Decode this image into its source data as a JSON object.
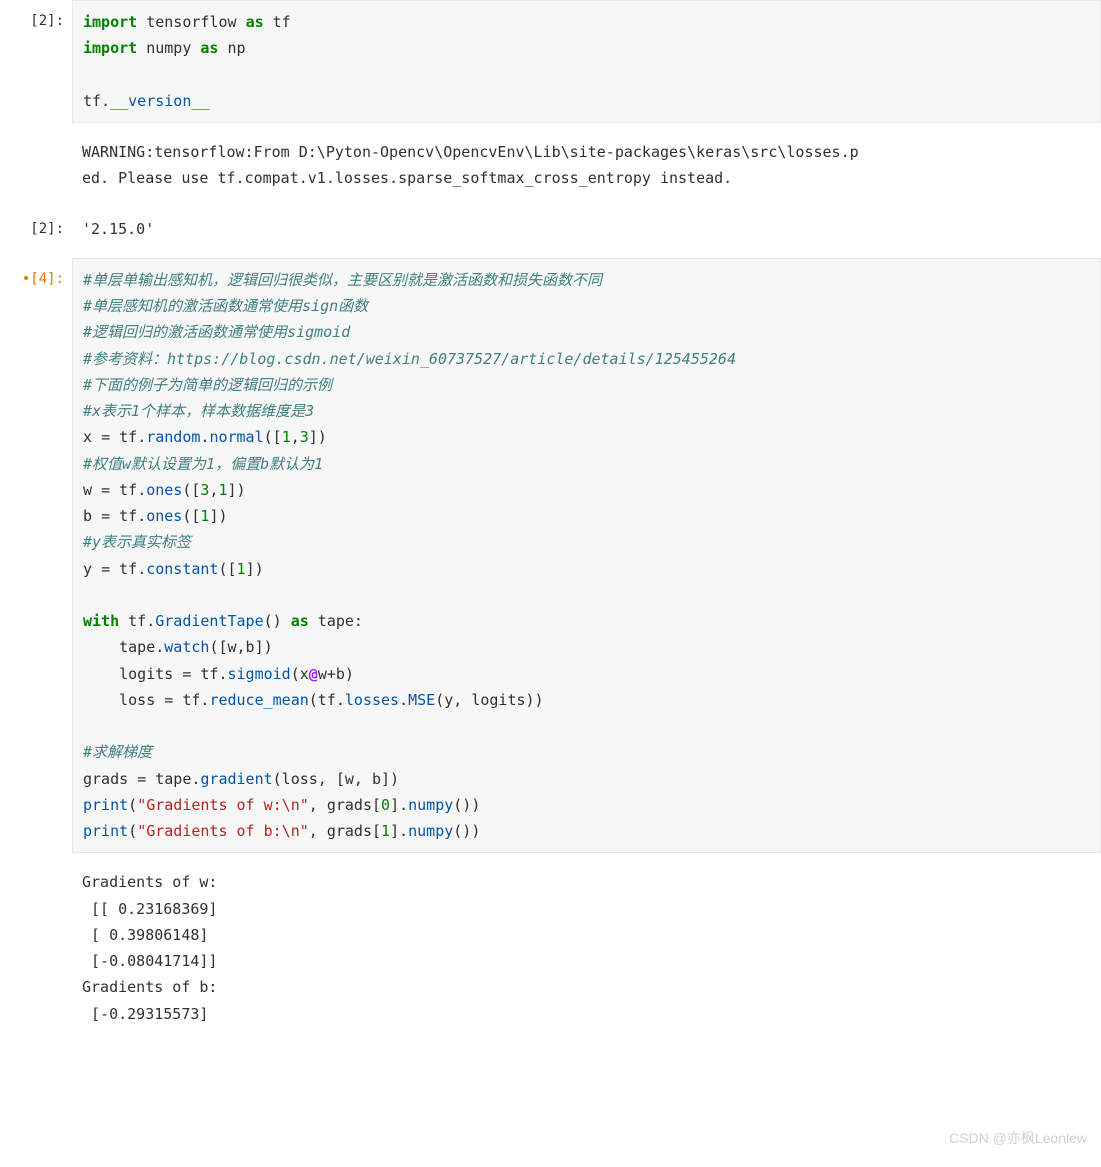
{
  "cells": [
    {
      "prompt": "[2]:",
      "type": "input",
      "mod": false,
      "lines": [
        {
          "cls": "",
          "tokens": [
            {
              "t": "import",
              "c": "kw"
            },
            {
              "t": " tensorflow ",
              "c": "nm"
            },
            {
              "t": "as",
              "c": "kw"
            },
            {
              "t": " tf",
              "c": "nm"
            }
          ]
        },
        {
          "cls": "",
          "tokens": [
            {
              "t": "import",
              "c": "kw"
            },
            {
              "t": " numpy ",
              "c": "nm"
            },
            {
              "t": "as",
              "c": "kw"
            },
            {
              "t": " np",
              "c": "nm"
            }
          ]
        },
        {
          "cls": "",
          "tokens": [
            {
              "t": "",
              "c": "nm"
            }
          ]
        },
        {
          "cls": "",
          "tokens": [
            {
              "t": "tf",
              "c": "nm"
            },
            {
              "t": ".",
              "c": "nm"
            },
            {
              "t": "__version__",
              "c": "fn"
            }
          ]
        }
      ]
    },
    {
      "prompt": "",
      "type": "output",
      "mod": false,
      "plain": "WARNING:tensorflow:From D:\\Pyton-Opencv\\OpencvEnv\\Lib\\site-packages\\keras\\src\\losses.p\ned. Please use tf.compat.v1.losses.sparse_softmax_cross_entropy instead."
    },
    {
      "prompt": "[2]:",
      "type": "output",
      "mod": false,
      "plain": "'2.15.0'"
    },
    {
      "prompt": "[4]:",
      "type": "input",
      "mod": true,
      "lines": [
        {
          "cls": "",
          "tokens": [
            {
              "t": "#单层单输出感知机，逻辑回归很类似，主要区别就是激活函数和损失函数不同",
              "c": "cmt"
            }
          ]
        },
        {
          "cls": "",
          "tokens": [
            {
              "t": "#单层感知机的激活函数通常使用sign函数",
              "c": "cmt"
            }
          ]
        },
        {
          "cls": "",
          "tokens": [
            {
              "t": "#逻辑回归的激活函数通常使用sigmoid",
              "c": "cmt"
            }
          ]
        },
        {
          "cls": "",
          "tokens": [
            {
              "t": "#参考资料：https://blog.csdn.net/weixin_60737527/article/details/125455264",
              "c": "cmt"
            }
          ]
        },
        {
          "cls": "",
          "tokens": [
            {
              "t": "#下面的例子为简单的逻辑回归的示例",
              "c": "cmt"
            }
          ]
        },
        {
          "cls": "",
          "tokens": [
            {
              "t": "#x表示1个样本，样本数据维度是3",
              "c": "cmt"
            }
          ]
        },
        {
          "cls": "",
          "tokens": [
            {
              "t": "x ",
              "c": "nm"
            },
            {
              "t": "=",
              "c": "nm"
            },
            {
              "t": " tf",
              "c": "nm"
            },
            {
              "t": ".",
              "c": "nm"
            },
            {
              "t": "random",
              "c": "fn"
            },
            {
              "t": ".",
              "c": "nm"
            },
            {
              "t": "normal",
              "c": "fn"
            },
            {
              "t": "([",
              "c": "nm"
            },
            {
              "t": "1",
              "c": "num"
            },
            {
              "t": ",",
              "c": "nm"
            },
            {
              "t": "3",
              "c": "num"
            },
            {
              "t": "])",
              "c": "nm"
            }
          ]
        },
        {
          "cls": "",
          "tokens": [
            {
              "t": "#权值w默认设置为1，偏置b默认为1",
              "c": "cmt"
            }
          ]
        },
        {
          "cls": "",
          "tokens": [
            {
              "t": "w ",
              "c": "nm"
            },
            {
              "t": "=",
              "c": "nm"
            },
            {
              "t": " tf",
              "c": "nm"
            },
            {
              "t": ".",
              "c": "nm"
            },
            {
              "t": "ones",
              "c": "fn"
            },
            {
              "t": "([",
              "c": "nm"
            },
            {
              "t": "3",
              "c": "num"
            },
            {
              "t": ",",
              "c": "nm"
            },
            {
              "t": "1",
              "c": "num"
            },
            {
              "t": "])",
              "c": "nm"
            }
          ]
        },
        {
          "cls": "",
          "tokens": [
            {
              "t": "b ",
              "c": "nm"
            },
            {
              "t": "=",
              "c": "nm"
            },
            {
              "t": " tf",
              "c": "nm"
            },
            {
              "t": ".",
              "c": "nm"
            },
            {
              "t": "ones",
              "c": "fn"
            },
            {
              "t": "([",
              "c": "nm"
            },
            {
              "t": "1",
              "c": "num"
            },
            {
              "t": "])",
              "c": "nm"
            }
          ]
        },
        {
          "cls": "",
          "tokens": [
            {
              "t": "#y表示真实标签",
              "c": "cmt"
            }
          ]
        },
        {
          "cls": "",
          "tokens": [
            {
              "t": "y ",
              "c": "nm"
            },
            {
              "t": "=",
              "c": "nm"
            },
            {
              "t": " tf",
              "c": "nm"
            },
            {
              "t": ".",
              "c": "nm"
            },
            {
              "t": "constant",
              "c": "fn"
            },
            {
              "t": "([",
              "c": "nm"
            },
            {
              "t": "1",
              "c": "num"
            },
            {
              "t": "])",
              "c": "nm"
            }
          ]
        },
        {
          "cls": "",
          "tokens": [
            {
              "t": "",
              "c": "nm"
            }
          ]
        },
        {
          "cls": "",
          "tokens": [
            {
              "t": "with",
              "c": "kw"
            },
            {
              "t": " tf",
              "c": "nm"
            },
            {
              "t": ".",
              "c": "nm"
            },
            {
              "t": "GradientTape",
              "c": "fn"
            },
            {
              "t": "() ",
              "c": "nm"
            },
            {
              "t": "as",
              "c": "kw"
            },
            {
              "t": " tape:",
              "c": "nm"
            }
          ]
        },
        {
          "cls": "",
          "tokens": [
            {
              "t": "    tape",
              "c": "nm"
            },
            {
              "t": ".",
              "c": "nm"
            },
            {
              "t": "watch",
              "c": "fn"
            },
            {
              "t": "([w,b])",
              "c": "nm"
            }
          ]
        },
        {
          "cls": "",
          "tokens": [
            {
              "t": "    logits ",
              "c": "nm"
            },
            {
              "t": "=",
              "c": "nm"
            },
            {
              "t": " tf",
              "c": "nm"
            },
            {
              "t": ".",
              "c": "nm"
            },
            {
              "t": "sigmoid",
              "c": "fn"
            },
            {
              "t": "(x",
              "c": "nm"
            },
            {
              "t": "@",
              "c": "op"
            },
            {
              "t": "w",
              "c": "nm"
            },
            {
              "t": "+",
              "c": "nm"
            },
            {
              "t": "b)",
              "c": "nm"
            }
          ]
        },
        {
          "cls": "",
          "tokens": [
            {
              "t": "    loss ",
              "c": "nm"
            },
            {
              "t": "=",
              "c": "nm"
            },
            {
              "t": " tf",
              "c": "nm"
            },
            {
              "t": ".",
              "c": "nm"
            },
            {
              "t": "reduce_mean",
              "c": "fn"
            },
            {
              "t": "(tf",
              "c": "nm"
            },
            {
              "t": ".",
              "c": "nm"
            },
            {
              "t": "losses",
              "c": "fn"
            },
            {
              "t": ".",
              "c": "nm"
            },
            {
              "t": "MSE",
              "c": "fn"
            },
            {
              "t": "(y, logits))",
              "c": "nm"
            }
          ]
        },
        {
          "cls": "",
          "tokens": [
            {
              "t": "",
              "c": "nm"
            }
          ]
        },
        {
          "cls": "",
          "tokens": [
            {
              "t": "#求解梯度",
              "c": "cmt"
            }
          ]
        },
        {
          "cls": "",
          "tokens": [
            {
              "t": "grads ",
              "c": "nm"
            },
            {
              "t": "=",
              "c": "nm"
            },
            {
              "t": " tape",
              "c": "nm"
            },
            {
              "t": ".",
              "c": "nm"
            },
            {
              "t": "gradient",
              "c": "fn"
            },
            {
              "t": "(loss, [w, b])",
              "c": "nm"
            }
          ]
        },
        {
          "cls": "",
          "tokens": [
            {
              "t": "print",
              "c": "fn"
            },
            {
              "t": "(",
              "c": "nm"
            },
            {
              "t": "\"Gradients of w:\\n\"",
              "c": "str"
            },
            {
              "t": ", grads[",
              "c": "nm"
            },
            {
              "t": "0",
              "c": "num"
            },
            {
              "t": "]",
              "c": "nm"
            },
            {
              "t": ".",
              "c": "nm"
            },
            {
              "t": "numpy",
              "c": "fn"
            },
            {
              "t": "())",
              "c": "nm"
            }
          ]
        },
        {
          "cls": "",
          "tokens": [
            {
              "t": "print",
              "c": "fn"
            },
            {
              "t": "(",
              "c": "nm"
            },
            {
              "t": "\"Gradients of b:\\n\"",
              "c": "str"
            },
            {
              "t": ", grads[",
              "c": "nm"
            },
            {
              "t": "1",
              "c": "num"
            },
            {
              "t": "]",
              "c": "nm"
            },
            {
              "t": ".",
              "c": "nm"
            },
            {
              "t": "numpy",
              "c": "fn"
            },
            {
              "t": "())",
              "c": "nm"
            }
          ]
        }
      ]
    },
    {
      "prompt": "",
      "type": "output",
      "mod": false,
      "plain": "Gradients of w:\n [[ 0.23168369]\n [ 0.39806148]\n [-0.08041714]]\nGradients of b:\n [-0.29315573]"
    }
  ],
  "watermark": "CSDN @亦枫Leonlew"
}
